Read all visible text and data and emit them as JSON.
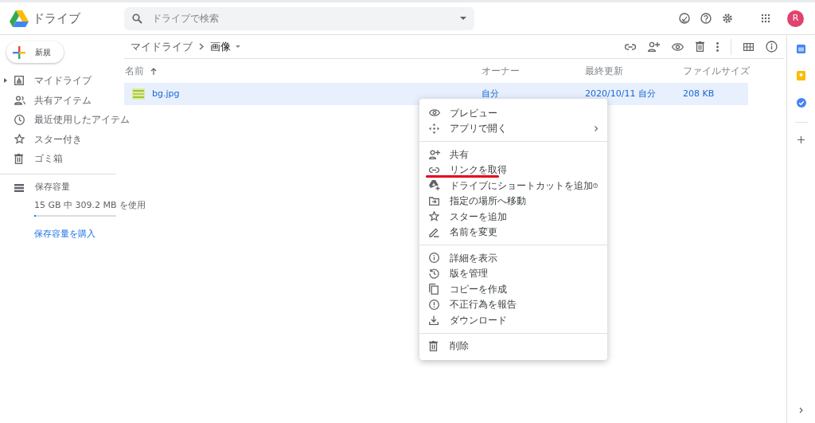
{
  "header": {
    "app_name": "ドライブ",
    "search": {
      "placeholder": "ドライブで検索"
    },
    "avatar": "R"
  },
  "sidebar": {
    "new_button": "新規",
    "items": [
      {
        "label": "マイドライブ",
        "expandable": true
      },
      {
        "label": "共有アイテム",
        "expandable": false
      },
      {
        "label": "最近使用したアイテム",
        "expandable": false
      },
      {
        "label": "スター付き",
        "expandable": false
      },
      {
        "label": "ゴミ箱",
        "expandable": false
      }
    ],
    "storage": {
      "label": "保存容量",
      "usage": "15 GB 中 309.2 MB を使用",
      "level": 0.02,
      "buy_link": "保存容量を購入"
    }
  },
  "breadcrumb": [
    "マイドライブ",
    "画像"
  ],
  "table": {
    "columns": [
      "名前",
      "オーナー",
      "最終更新",
      "ファイルサイズ"
    ],
    "rows": [
      {
        "name": "bg.jpg",
        "owner": "自分",
        "modified": "2020/10/11 自分",
        "size": "208 KB",
        "selected": true
      }
    ]
  },
  "context_menu": {
    "sections": [
      [
        {
          "label": "プレビュー",
          "submenu": false,
          "help": false,
          "underlined": false
        },
        {
          "label": "アプリで開く",
          "submenu": true,
          "help": false,
          "underlined": false
        }
      ],
      [
        {
          "label": "共有",
          "submenu": false,
          "help": false,
          "underlined": false
        },
        {
          "label": "リンクを取得",
          "submenu": false,
          "help": false,
          "underlined": true
        },
        {
          "label": "ドライブにショートカットを追加",
          "submenu": false,
          "help": true,
          "underlined": false
        },
        {
          "label": "指定の場所へ移動",
          "submenu": false,
          "help": false,
          "underlined": false
        },
        {
          "label": "スターを追加",
          "submenu": false,
          "help": false,
          "underlined": false
        },
        {
          "label": "名前を変更",
          "submenu": false,
          "help": false,
          "underlined": false
        }
      ],
      [
        {
          "label": "詳細を表示",
          "submenu": false,
          "help": false,
          "underlined": false
        },
        {
          "label": "版を管理",
          "submenu": false,
          "help": false,
          "underlined": false
        },
        {
          "label": "コピーを作成",
          "submenu": false,
          "help": false,
          "underlined": false
        },
        {
          "label": "不正行為を報告",
          "submenu": false,
          "help": false,
          "underlined": false
        },
        {
          "label": "ダウンロード",
          "submenu": false,
          "help": false,
          "underlined": false
        }
      ],
      [
        {
          "label": "削除",
          "submenu": false,
          "help": false,
          "underlined": false
        }
      ]
    ]
  }
}
